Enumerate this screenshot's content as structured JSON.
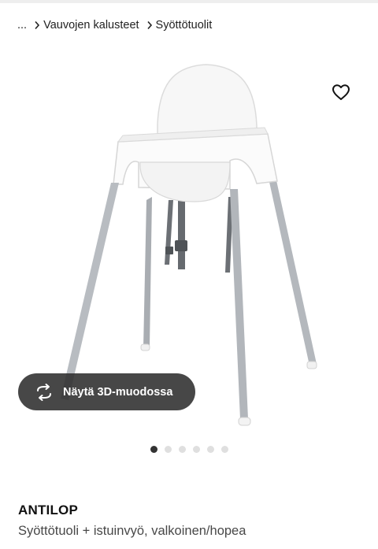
{
  "breadcrumb": {
    "ellipsis": "...",
    "items": [
      {
        "label": "Vauvojen kalusteet"
      },
      {
        "label": "Syöttötuolit"
      }
    ]
  },
  "gallery": {
    "image_count": 6,
    "active_index": 0,
    "view_3d_label": "Näytä 3D-muodossa"
  },
  "icons": {
    "wishlist": "heart-outline-icon",
    "view_3d": "rotate-3d-icon",
    "breadcrumb_separator": "chevron-right-icon"
  },
  "product": {
    "name": "ANTILOP",
    "description": "Syöttötuoli + istuinvyö, valkoinen/hopea"
  },
  "colors": {
    "text": "#111111",
    "muted": "#484848",
    "button_bg": "#2d2d2d",
    "dot_active": "#333333",
    "dot_inactive": "#dfdfdf"
  }
}
